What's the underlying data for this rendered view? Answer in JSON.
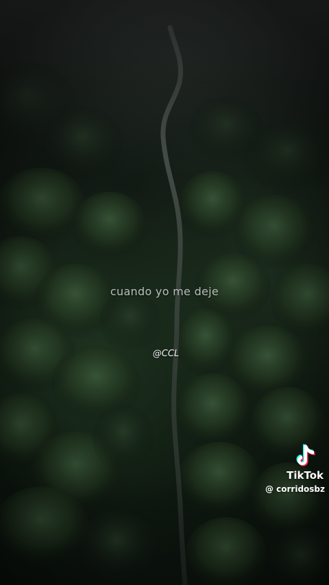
{
  "overlay": {
    "lyric": "cuando yo me deje",
    "handle": "@CCL"
  },
  "watermark": {
    "logo_icon": "tiktok-logo-icon",
    "brand": "TikTok",
    "username": "@ corridosbz"
  },
  "background": {
    "scene": "aerial-forest-road",
    "colors": {
      "canopy_dark": "#0d150e",
      "canopy_light": "#2f4a30",
      "road": "#3a3f3c",
      "haze": "#3c4240"
    }
  }
}
